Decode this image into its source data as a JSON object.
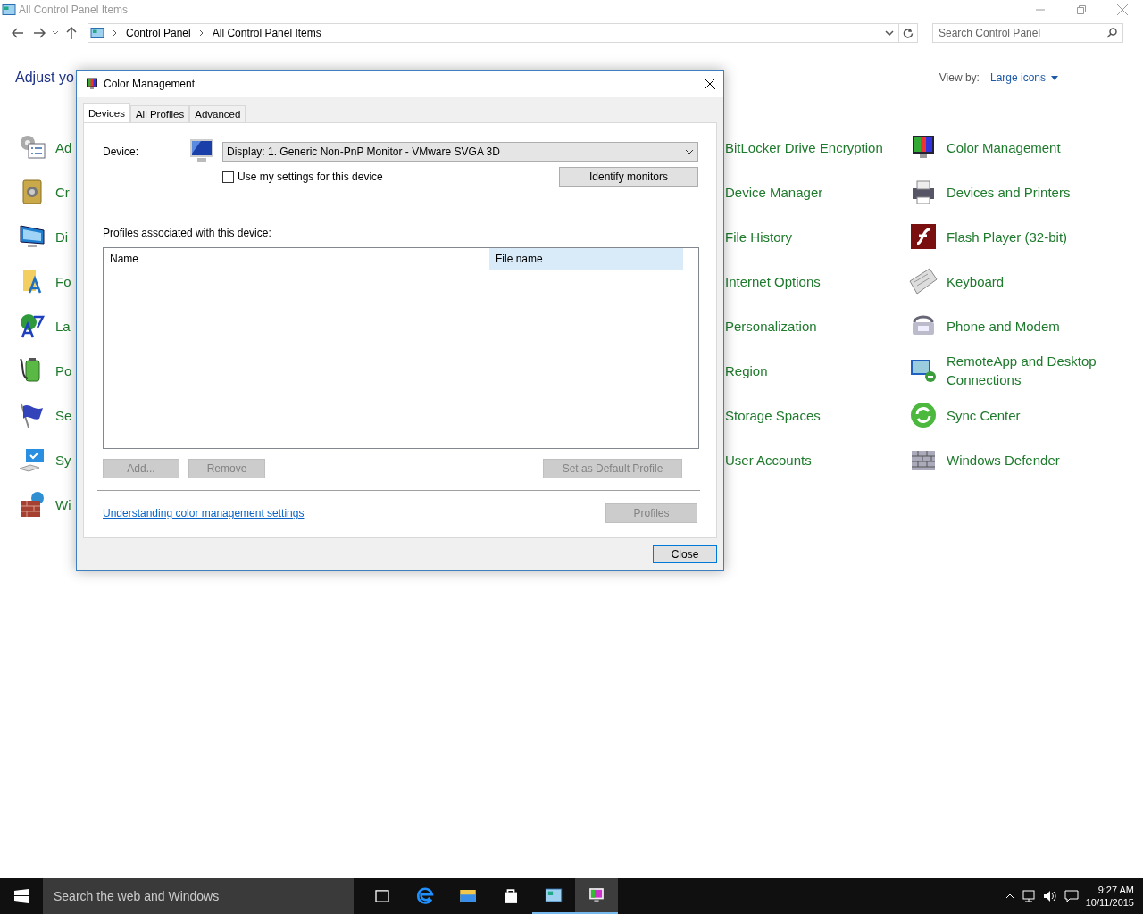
{
  "window": {
    "title": "All Control Panel Items"
  },
  "address": {
    "crumbs": [
      "Control Panel",
      "All Control Panel Items"
    ]
  },
  "search": {
    "placeholder": "Search Control Panel"
  },
  "header": {
    "title": "Adjust yo",
    "view_by_label": "View by:",
    "view_by_value": "Large icons"
  },
  "items_columns": [
    [
      {
        "label": "Ad"
      },
      {
        "label": "Cr"
      },
      {
        "label": "Di"
      },
      {
        "label": "Fo"
      },
      {
        "label": "La"
      },
      {
        "label": "Po"
      },
      {
        "label": "Se"
      },
      {
        "label": "Sy"
      },
      {
        "label": "Wi"
      }
    ],
    [
      {
        "label": "BitLocker Drive Encryption"
      },
      {
        "label": "Device Manager"
      },
      {
        "label": "File History"
      },
      {
        "label": "Internet Options"
      },
      {
        "label": "Personalization"
      },
      {
        "label": "Region"
      },
      {
        "label": "Storage Spaces"
      },
      {
        "label": "User Accounts"
      }
    ],
    [
      {
        "label": "Color Management"
      },
      {
        "label": "Devices and Printers"
      },
      {
        "label": "Flash Player (32-bit)"
      },
      {
        "label": "Keyboard"
      },
      {
        "label": "Phone and Modem"
      },
      {
        "label": "RemoteApp and Desktop Connections"
      },
      {
        "label": "Sync Center"
      },
      {
        "label": "Windows Defender"
      }
    ]
  ],
  "dialog": {
    "title": "Color Management",
    "tabs": [
      {
        "label": "Devices",
        "selected": true
      },
      {
        "label": "All Profiles",
        "selected": false
      },
      {
        "label": "Advanced",
        "selected": false
      }
    ],
    "device_label": "Device:",
    "device_value": "Display: 1. Generic Non-PnP Monitor - VMware SVGA 3D",
    "use_my_settings": {
      "label": "Use my settings for this device",
      "checked": false
    },
    "identify_button": "Identify monitors",
    "profiles_label": "Profiles associated with this device:",
    "columns": [
      {
        "label": "Name",
        "highlighted": false
      },
      {
        "label": "File name",
        "highlighted": true
      }
    ],
    "buttons": [
      {
        "label": "Add...",
        "disabled": true
      },
      {
        "label": "Remove",
        "disabled": true
      },
      {
        "label": "Set as Default Profile",
        "disabled": true
      }
    ],
    "link": "Understanding color management settings",
    "profiles_button": {
      "label": "Profiles",
      "disabled": true
    },
    "close_button": "Close"
  },
  "taskbar": {
    "search_placeholder": "Search the web and Windows",
    "apps": [
      {
        "open": false,
        "selected": false
      },
      {
        "open": false,
        "selected": false
      },
      {
        "open": false,
        "selected": false
      },
      {
        "open": false,
        "selected": false
      },
      {
        "open": true,
        "selected": false
      },
      {
        "open": true,
        "selected": true
      }
    ],
    "time": "9:27 AM",
    "date": "10/11/2015"
  }
}
